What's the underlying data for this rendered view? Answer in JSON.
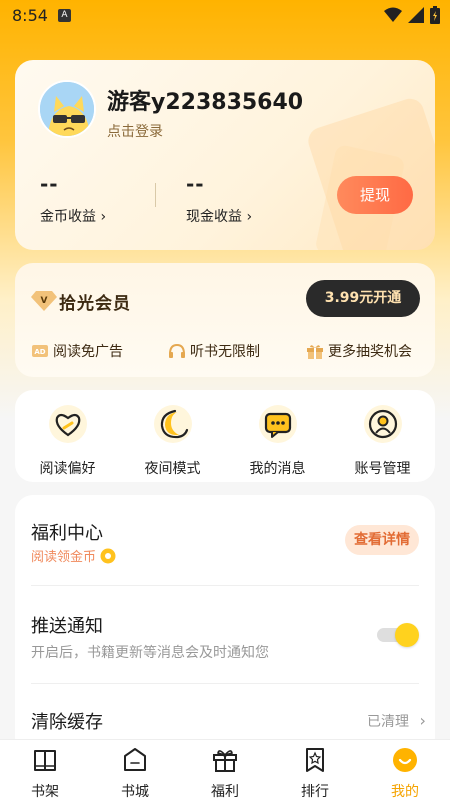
{
  "status": {
    "time": "8:54",
    "notif_badge": "A"
  },
  "account": {
    "username": "游客y223835640",
    "login_hint": "点击登录",
    "coin_value": "--",
    "coin_label": "金币收益",
    "cash_value": "--",
    "cash_label": "现金收益",
    "withdraw_label": "提现",
    "chevron": "›"
  },
  "vip": {
    "title": "拾光会员",
    "badge": "V",
    "button_label": "3.99元开通",
    "perks": [
      {
        "label": "阅读免广告",
        "icon": "ad-free-icon"
      },
      {
        "label": "听书无限制",
        "icon": "headphones-icon"
      },
      {
        "label": "更多抽奖机会",
        "icon": "gift-icon"
      }
    ]
  },
  "tools": [
    {
      "label": "阅读偏好",
      "icon": "heart-icon"
    },
    {
      "label": "夜间模式",
      "icon": "moon-icon"
    },
    {
      "label": "我的消息",
      "icon": "message-icon"
    },
    {
      "label": "账号管理",
      "icon": "user-icon"
    }
  ],
  "settings": {
    "welfare_title": "福利中心",
    "welfare_sub": "阅读领金币",
    "detail_label": "查看详情",
    "push_title": "推送通知",
    "push_sub": "开启后，书籍更新等消息会及时通知您",
    "push_enabled": true,
    "cache_title": "清除缓存",
    "cache_value": "已清理"
  },
  "tabs": [
    {
      "label": "书架",
      "icon": "bookshelf-icon",
      "active": false
    },
    {
      "label": "书城",
      "icon": "bookstore-icon",
      "active": false
    },
    {
      "label": "福利",
      "icon": "welfare-icon",
      "active": false
    },
    {
      "label": "排行",
      "icon": "ranking-icon",
      "active": false
    },
    {
      "label": "我的",
      "icon": "profile-icon",
      "active": true
    }
  ],
  "colors": {
    "accent": "#ffb300",
    "withdraw": "#ff6a44",
    "active_tab": "#f5a300",
    "toggle_on": "#ffd21e"
  }
}
